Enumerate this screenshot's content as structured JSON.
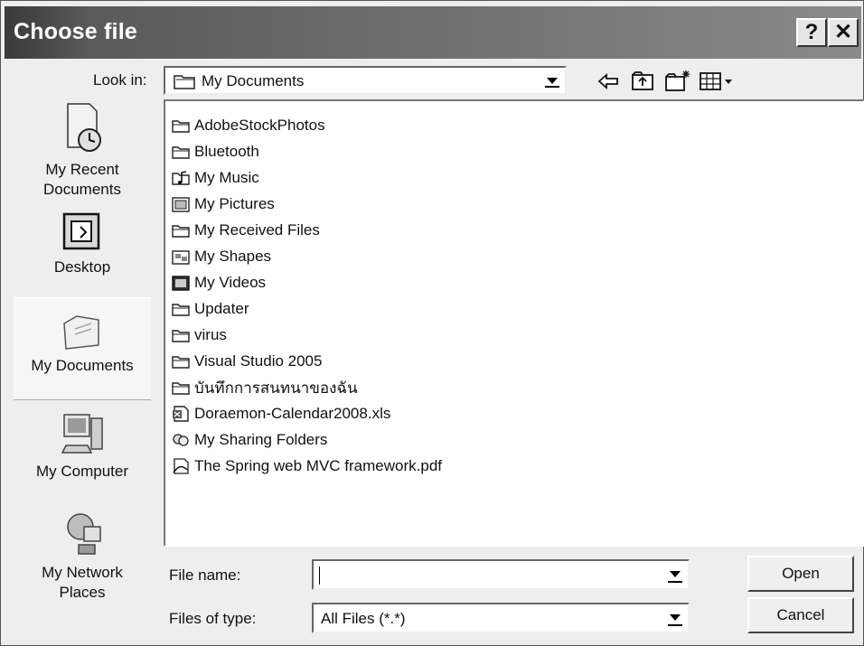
{
  "window": {
    "title": "Choose file",
    "help_label": "?",
    "close_label": "✕"
  },
  "toolbar": {
    "look_in_label": "Look in:",
    "look_in_value": "My Documents",
    "icons": [
      "back-icon",
      "up-folder-icon",
      "new-folder-icon",
      "view-menu-icon"
    ]
  },
  "places": [
    {
      "label_lines": [
        "My Recent",
        "Documents"
      ],
      "icon": "recent-documents-icon"
    },
    {
      "label_lines": [
        "Desktop"
      ],
      "icon": "desktop-icon"
    },
    {
      "label_lines": [
        "My Documents"
      ],
      "icon": "my-documents-icon",
      "selected": true
    },
    {
      "label_lines": [
        "My Computer"
      ],
      "icon": "my-computer-icon"
    },
    {
      "label_lines": [
        "My Network",
        "Places"
      ],
      "icon": "network-places-icon"
    }
  ],
  "files": [
    {
      "name": "AdobeStockPhotos",
      "icon": "folder-icon"
    },
    {
      "name": "Bluetooth",
      "icon": "folder-icon"
    },
    {
      "name": "My Music",
      "icon": "music-folder-icon"
    },
    {
      "name": "My Pictures",
      "icon": "pictures-folder-icon"
    },
    {
      "name": "My Received Files",
      "icon": "folder-icon"
    },
    {
      "name": "My Shapes",
      "icon": "shapes-folder-icon"
    },
    {
      "name": "My Videos",
      "icon": "videos-folder-icon"
    },
    {
      "name": "Updater",
      "icon": "folder-icon"
    },
    {
      "name": "virus",
      "icon": "folder-icon"
    },
    {
      "name": "Visual Studio 2005",
      "icon": "folder-icon"
    },
    {
      "name": "บันทึกการสนทนาของฉัน",
      "icon": "folder-icon"
    },
    {
      "name": "Doraemon-Calendar2008.xls",
      "icon": "excel-file-icon"
    },
    {
      "name": "My Sharing Folders",
      "icon": "sharing-folders-icon"
    },
    {
      "name": "The Spring web MVC framework.pdf",
      "icon": "pdf-file-icon"
    }
  ],
  "form": {
    "file_name_label": "File name:",
    "file_name_value": "",
    "file_type_label": "Files of type:",
    "file_type_value": "All Files (*.*)"
  },
  "buttons": {
    "open": "Open",
    "cancel": "Cancel"
  }
}
